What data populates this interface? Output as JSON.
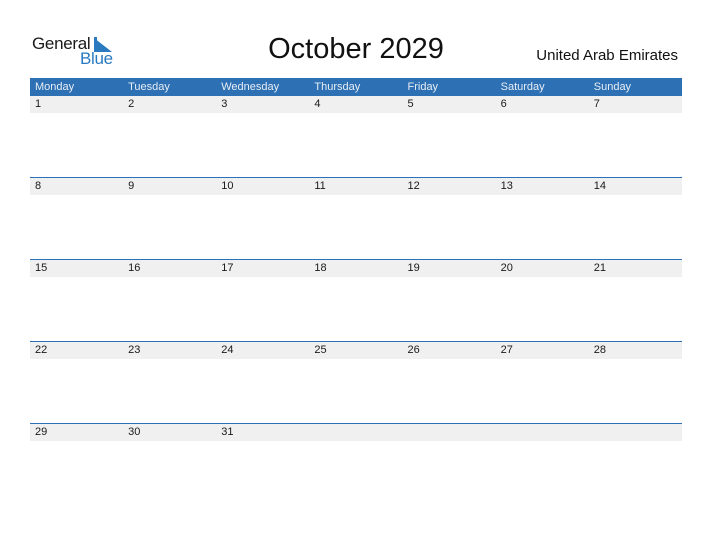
{
  "logo": {
    "line1": "General",
    "line2": "Blue"
  },
  "title": "October 2029",
  "country": "United Arab Emirates",
  "colors": {
    "accent": "#2d70b3",
    "logo_blue": "#2a7ac0",
    "day_strip": "#f0f0f0"
  },
  "weekdays": [
    "Monday",
    "Tuesday",
    "Wednesday",
    "Thursday",
    "Friday",
    "Saturday",
    "Sunday"
  ],
  "weeks": [
    [
      "1",
      "2",
      "3",
      "4",
      "5",
      "6",
      "7"
    ],
    [
      "8",
      "9",
      "10",
      "11",
      "12",
      "13",
      "14"
    ],
    [
      "15",
      "16",
      "17",
      "18",
      "19",
      "20",
      "21"
    ],
    [
      "22",
      "23",
      "24",
      "25",
      "26",
      "27",
      "28"
    ],
    [
      "29",
      "30",
      "31",
      "",
      "",
      "",
      ""
    ]
  ]
}
